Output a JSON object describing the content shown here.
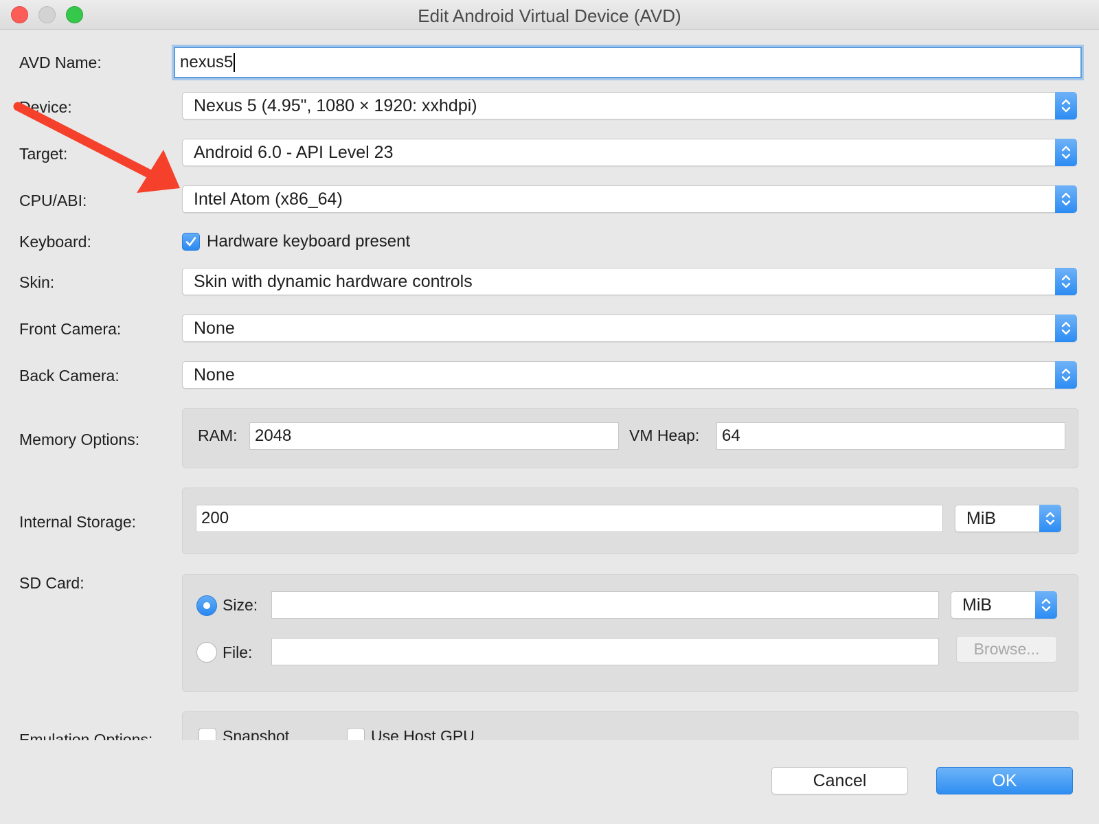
{
  "window": {
    "title": "Edit Android Virtual Device (AVD)"
  },
  "form": {
    "avd_name": {
      "label": "AVD Name:",
      "value": "nexus5"
    },
    "device": {
      "label": "Device:",
      "value": "Nexus 5 (4.95\", 1080 × 1920: xxhdpi)"
    },
    "target": {
      "label": "Target:",
      "value": "Android 6.0 - API Level 23"
    },
    "cpu_abi": {
      "label": "CPU/ABI:",
      "value": "Intel Atom (x86_64)"
    },
    "keyboard": {
      "label": "Keyboard:",
      "checkbox_label": "Hardware keyboard present",
      "checked": true
    },
    "skin": {
      "label": "Skin:",
      "value": "Skin with dynamic hardware controls"
    },
    "front_camera": {
      "label": "Front Camera:",
      "value": "None"
    },
    "back_camera": {
      "label": "Back Camera:",
      "value": "None"
    },
    "memory": {
      "label": "Memory Options:",
      "ram_label": "RAM:",
      "ram_value": "2048",
      "vm_heap_label": "VM Heap:",
      "vm_heap_value": "64"
    },
    "internal_storage": {
      "label": "Internal Storage:",
      "value": "200",
      "unit": "MiB"
    },
    "sd_card": {
      "label": "SD Card:",
      "size_label": "Size:",
      "size_value": "",
      "size_unit": "MiB",
      "size_selected": true,
      "file_label": "File:",
      "file_value": "",
      "browse_label": "Browse..."
    },
    "emulation": {
      "label": "Emulation Options:",
      "snapshot_label": "Snapshot",
      "snapshot_checked": false,
      "host_gpu_label": "Use Host GPU",
      "host_gpu_checked": false
    }
  },
  "buttons": {
    "cancel": "Cancel",
    "ok": "OK"
  },
  "colors": {
    "accent": "#2c8cf3",
    "annotation_arrow": "#f5412b"
  },
  "icons": {
    "popup_stepper": "up-down-chevron-icon",
    "checkmark": "checkmark-icon",
    "annotation": "red-arrow-annotation"
  }
}
